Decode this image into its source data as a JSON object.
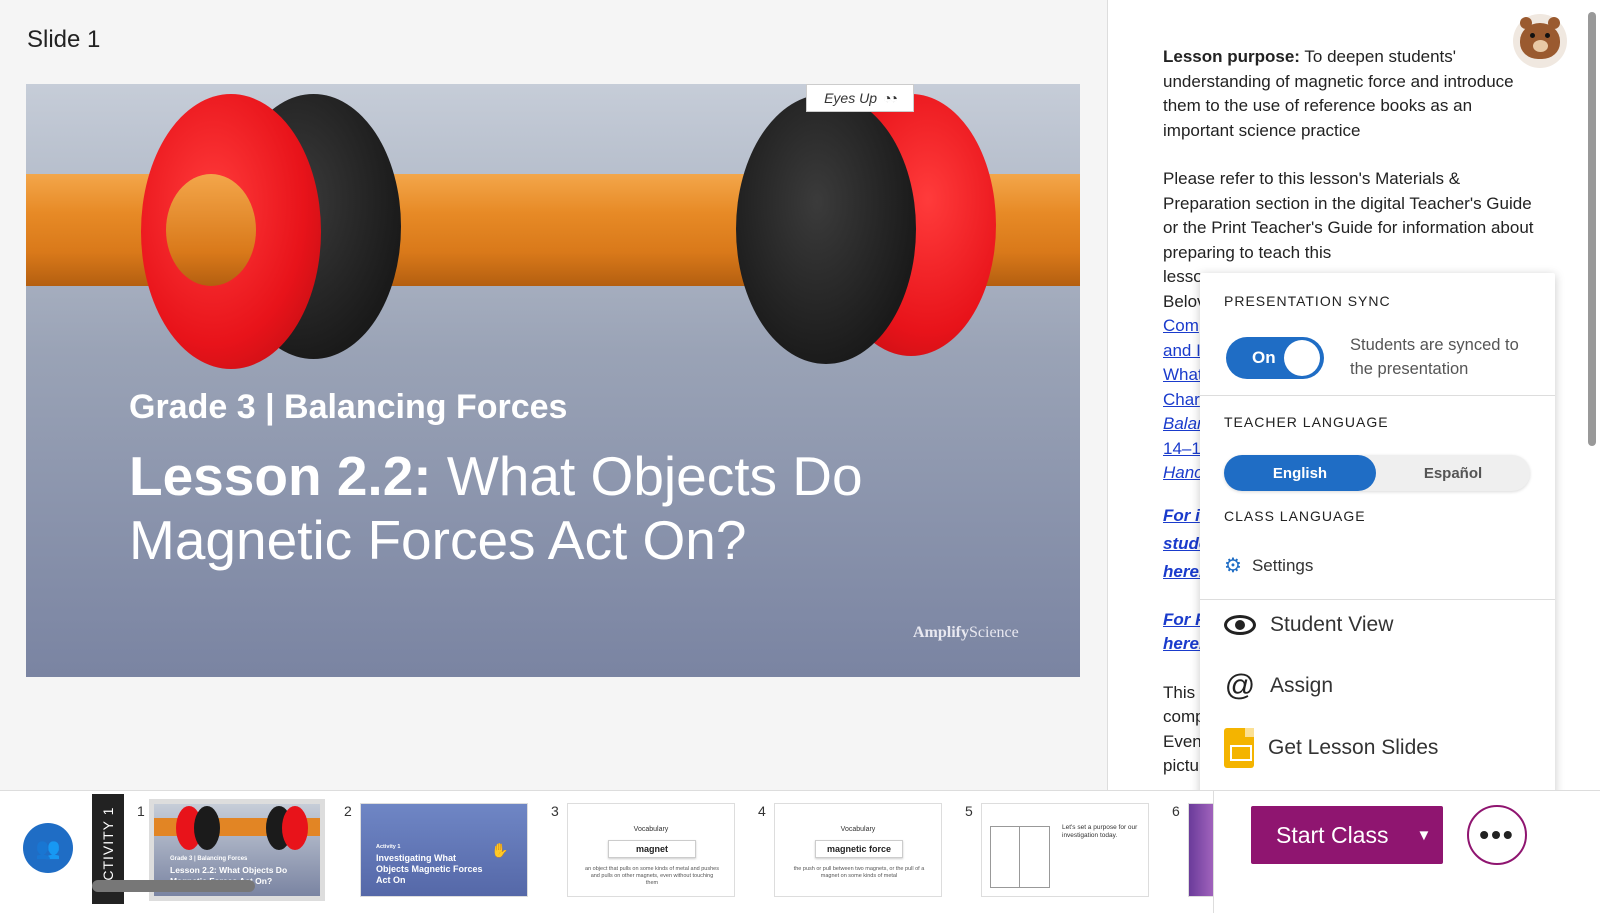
{
  "slide_header": {
    "title": "Slide 1"
  },
  "slide": {
    "eyes_up": "Eyes Up",
    "grade_line": "Grade 3 | Balancing Forces",
    "lesson_prefix": "Lesson 2.2:",
    "lesson_title": "What Objects Do Magnetic Forces Act On?",
    "brand_a": "Amplify",
    "brand_b": "Science"
  },
  "notes": {
    "purpose_label": "Lesson purpose:",
    "purpose_text": "To deepen students' understanding of magnetic force and introduce them to the use of reference books as an important science practice",
    "para2": "Please refer to this lesson's Materials & Preparation section in the digital Teacher's Guide or the Print Teacher's Guide for information about preparing to teach this",
    "frag_lesson": "lesso",
    "frag_below": "Belov",
    "link_com": "Com",
    "link_and": "and I",
    "link_what": "What",
    "link_char": "Char",
    "link_bala": "Balar",
    "link_pages": "14–1",
    "link_hand": "Hanc",
    "link_for1": "For i",
    "link_stude": "stude",
    "link_here1": "here.",
    "link_for2": "For F",
    "link_here2": "here.",
    "frag_this": "This",
    "frag_comp": "comp",
    "frag_even": "Even",
    "frag_pict": "pictu"
  },
  "popup": {
    "sync_title": "PRESENTATION SYNC",
    "sync_toggle": "On",
    "sync_desc": "Students are synced to the presentation",
    "teacher_lang_title": "TEACHER LANGUAGE",
    "lang_en": "English",
    "lang_es": "Español",
    "class_lang_title": "CLASS LANGUAGE",
    "settings": "Settings",
    "student_view": "Student View",
    "assign": "Assign",
    "get_slides": "Get Lesson Slides"
  },
  "filmstrip": {
    "activity_label": "ACTIVITY 1",
    "nums": [
      "1",
      "2",
      "3",
      "4",
      "5",
      "6"
    ],
    "t1_line1": "Grade 3 | Balancing Forces",
    "t1_line2": "Lesson 2.2: What Objects Do Magnetic Forces Act On?",
    "t2_small": "Activity 1",
    "t2_title": "Investigating What Objects Magnetic Forces Act On",
    "t3_header": "Vocabulary",
    "t3_word": "magnet",
    "t3_def": "an object that pulls on some kinds of metal and pushes and pulls on other magnets, even without touching them",
    "t4_header": "Vocabulary",
    "t4_word": "magnetic force",
    "t4_def": "the push or pull between two magnets, or the pull of a magnet on some kinds of metal",
    "t5_text": "Let's set a purpose for our investigation today."
  },
  "actions": {
    "start_class": "Start Class",
    "more": "•••"
  },
  "colors": {
    "accent_blue": "#1f6dc5",
    "brand_purple": "#8f1570",
    "link": "#1a3bcc"
  }
}
